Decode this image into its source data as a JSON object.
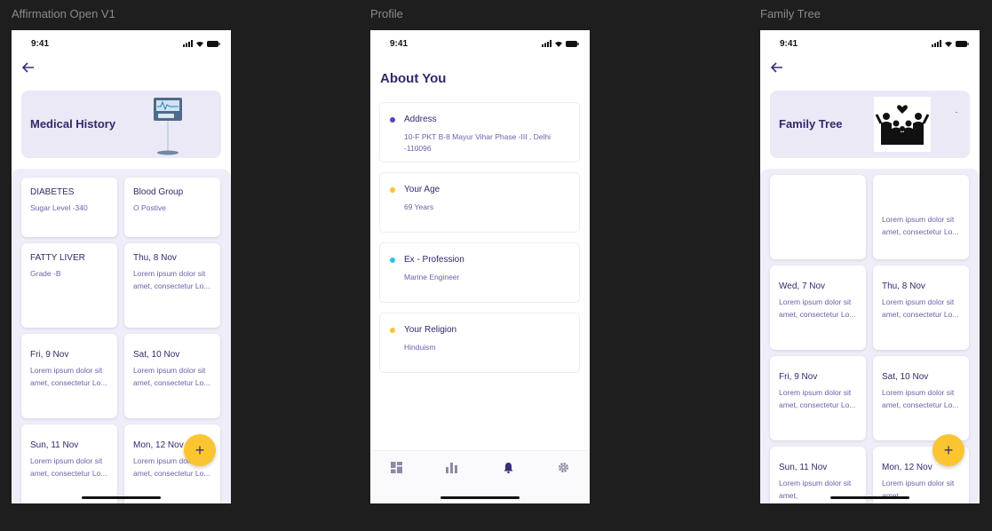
{
  "frames": {
    "left": {
      "label": "Affirmation Open V1"
    },
    "middle": {
      "label": "Profile"
    },
    "right": {
      "label": "Family Tree"
    }
  },
  "status_time": "9:41",
  "back_icon": "arrow-left-icon",
  "medical": {
    "title": "Medical History",
    "cards": [
      {
        "title": "DIABETES",
        "body": "Sugar Level -340"
      },
      {
        "title": "Blood Group",
        "body": "O Postive"
      },
      {
        "title": "FATTY LIVER",
        "body": "Grade -B"
      },
      {
        "title": "Thu, 8 Nov",
        "body": "Lorem ipsum dolor sit amet, consectetur Lo..."
      },
      {
        "title": "Fri, 9 Nov",
        "body": "Lorem ipsum dolor sit amet, consectetur Lo..."
      },
      {
        "title": "Sat, 10 Nov",
        "body": "Lorem ipsum dolor sit amet, consectetur Lo..."
      },
      {
        "title": "Sun, 11 Nov",
        "body": "Lorem ipsum dolor sit amet, consectetur Lo..."
      },
      {
        "title": "Mon, 12 Nov",
        "body": "Lorem ipsum dolor sit amet, consectetur Lo..."
      }
    ],
    "fab_label": "+"
  },
  "profile": {
    "heading": "About You",
    "items": [
      {
        "title": "Address",
        "value": "10-F PKT B-8 Mayur Vihar Phase -III , Delhi -110096",
        "dot_color": "#5b3fc4"
      },
      {
        "title": "Your Age",
        "value": "69 Years",
        "dot_color": "#fbc531"
      },
      {
        "title": "Ex - Profession",
        "value": "Marine Engineer",
        "dot_color": "#29c4e8"
      },
      {
        "title": "Your Religion",
        "value": "Hinduism",
        "dot_color": "#fbc531"
      }
    ],
    "tabs": [
      "dashboard-icon",
      "chart-icon",
      "bell-icon",
      "gear-icon"
    ],
    "active_tab": "bell-icon"
  },
  "family": {
    "title": "Family Tree",
    "cards": [
      {
        "title": "",
        "body": ""
      },
      {
        "title": "",
        "body": "Lorem ipsum dolor sit amet, consectetur Lo..."
      },
      {
        "title": "Wed, 7 Nov",
        "body": "Lorem ipsum dolor sit amet, consectetur Lo..."
      },
      {
        "title": "Thu, 8 Nov",
        "body": "Lorem ipsum dolor sit amet, consectetur Lo..."
      },
      {
        "title": "Fri, 9 Nov",
        "body": "Lorem ipsum dolor sit amet, consectetur Lo..."
      },
      {
        "title": "Sat, 10 Nov",
        "body": "Lorem ipsum dolor sit amet, consectetur Lo..."
      },
      {
        "title": "Sun, 11 Nov",
        "body": "Lorem ipsum dolor sit amet,"
      },
      {
        "title": "Mon, 12 Nov",
        "body": "Lorem ipsum dolor sit amet,"
      }
    ],
    "fab_label": "+"
  },
  "colors": {
    "primary": "#33296b",
    "accent": "#fbc531",
    "card_bg": "#ebe9f6"
  }
}
